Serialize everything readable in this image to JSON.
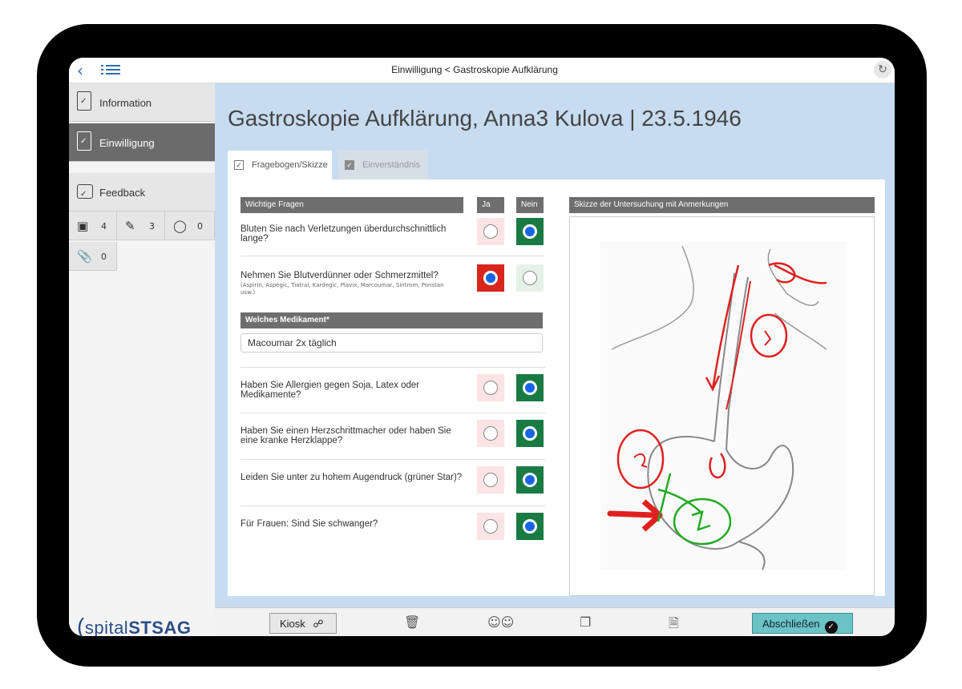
{
  "topbar": {
    "title": "Einwilligung < Gastroskopie Aufklärung"
  },
  "sidebar": {
    "items": [
      {
        "label": "Information"
      },
      {
        "label": "Einwilligung"
      },
      {
        "label": "Feedback"
      }
    ],
    "counters": {
      "camera": "4",
      "pencil": "3",
      "mic": "0",
      "attachment": "0"
    },
    "logo": {
      "part1": "spital",
      "part2": "STSAG"
    }
  },
  "main": {
    "title": "Gastroskopie Aufklärung, Anna3 Kulova | 23.5.1946",
    "tabs": [
      {
        "label": "Fragebogen/Skizze"
      },
      {
        "label": "Einverständnis"
      }
    ],
    "questions_header": "Wichtige Fragen",
    "col_yes": "Ja",
    "col_no": "Nein",
    "questions": [
      {
        "text": "Bluten Sie nach Verletzungen überdurchschnittlich lange?",
        "answer": "Nein"
      },
      {
        "text": "Nehmen Sie Blutverdünner oder Schmerzmittel?",
        "sub": "(Aspirin, Aspégic, Tiatral, Kardegic, Plavix, Marcoumar, Sintrom, Ponstan usw.)",
        "answer": "Ja"
      },
      {
        "text": "Haben Sie Allergien gegen Soja, Latex oder Medikamente?",
        "answer": "Nein"
      },
      {
        "text": "Haben Sie einen Herzschrittmacher oder haben Sie eine kranke Herzklappe?",
        "answer": "Nein"
      },
      {
        "text": "Leiden Sie unter zu hohem Augendruck (grüner Star)?",
        "answer": "Nein"
      },
      {
        "text": "Für Frauen: Sind Sie schwanger?",
        "answer": "Nein"
      }
    ],
    "medication_header": "Welches Medikament*",
    "medication_value": "Macoumar 2x täglich",
    "sketch_header": "Skizze der Untersuchung mit Anmerkungen"
  },
  "bottombar": {
    "kiosk_label": "Kiosk",
    "finish_label": "Abschließen"
  },
  "colors": {
    "accent": "#2a6fb5",
    "yes_on": "#d9261c",
    "no_on": "#1a7a44",
    "finish": "#6cc3c5",
    "main_bg": "#c7dcf0"
  },
  "icons": [
    "back-icon",
    "menu-icon",
    "refresh-icon",
    "document-icon",
    "feedback-icon",
    "camera-icon",
    "pencil-icon",
    "microphone-icon",
    "paperclip-icon",
    "lock-icon",
    "trash-icon",
    "people-icon",
    "copy-icon",
    "pdf-icon",
    "check-circle-icon"
  ]
}
